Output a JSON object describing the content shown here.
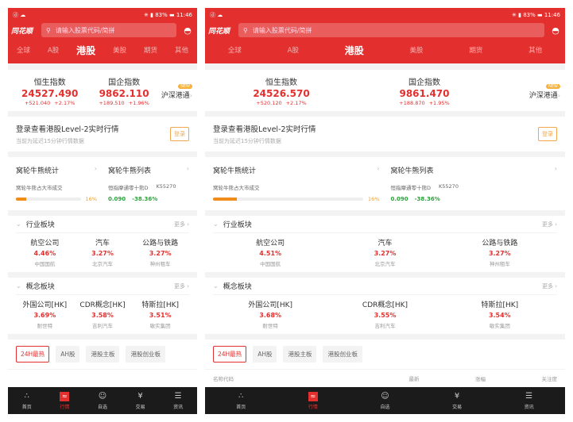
{
  "phones": [
    {
      "status": {
        "left": "ⓓ ☁",
        "right": "✳ ▮ 83% ▬ 11:46"
      },
      "logo": "同花顺",
      "search_placeholder": "请输入股票代码/简拼",
      "tabs": [
        "全球",
        "A股",
        "港股",
        "美股",
        "期货",
        "其他"
      ],
      "indices": [
        {
          "name": "恒生指数",
          "value": "24527.490",
          "change": "+521.040",
          "pct": "+2.17%"
        },
        {
          "name": "国企指数",
          "value": "9862.110",
          "change": "+189.510",
          "pct": "+1.96%"
        }
      ],
      "hs_badge": "NEW",
      "hs_label": "沪深港通",
      "login": {
        "title": "登录查看港股Level-2实时行情",
        "sub": "当前为延迟15分钟行情数据",
        "button": "登录"
      },
      "warrant": {
        "stats_title": "窝轮牛熊统计",
        "stats_sub": "窝轮牛熊占大市成交",
        "stats_pct": "16%",
        "stats_frac": 0.16,
        "list_title": "窝轮牛熊列表",
        "list_name": "恒指摩通零十熊D",
        "list_code": "K55270",
        "list_price": "0.090",
        "list_pct": "-38.36%"
      },
      "industry": {
        "title": "行业板块",
        "more": "更多",
        "items": [
          {
            "name": "航空公司",
            "pct": "4.46%",
            "stock": "中国国航"
          },
          {
            "name": "汽车",
            "pct": "3.27%",
            "stock": "北京汽车"
          },
          {
            "name": "公路与铁路",
            "pct": "3.27%",
            "stock": "神州租车"
          }
        ]
      },
      "concept": {
        "title": "概念板块",
        "more": "更多",
        "items": [
          {
            "name": "外国公司[HK]",
            "pct": "3.69%",
            "stock": "耐世特"
          },
          {
            "name": "CDR概念[HK]",
            "pct": "3.58%",
            "stock": "吉利汽车"
          },
          {
            "name": "特斯拉[HK]",
            "pct": "3.51%",
            "stock": "敏实集团"
          }
        ]
      },
      "chips": [
        "24H最热",
        "AH股",
        "港股主板",
        "港股创业板"
      ],
      "nav": [
        {
          "icon": "∴",
          "label": "首页"
        },
        {
          "icon": "≈",
          "label": "行情"
        },
        {
          "icon": "☺",
          "label": "自选"
        },
        {
          "icon": "¥",
          "label": "交易"
        },
        {
          "icon": "☰",
          "label": "资讯"
        }
      ]
    },
    {
      "status": {
        "left": "ⓓ ☁",
        "right": "✳ ▮ 83% ▬ 11:46"
      },
      "logo": "同花顺",
      "search_placeholder": "请输入股票代码/简拼",
      "tabs": [
        "全球",
        "A股",
        "港股",
        "美股",
        "期货",
        "其他"
      ],
      "indices": [
        {
          "name": "恒生指数",
          "value": "24526.570",
          "change": "+520.120",
          "pct": "+2.17%"
        },
        {
          "name": "国企指数",
          "value": "9861.470",
          "change": "+188.870",
          "pct": "+1.95%"
        }
      ],
      "hs_badge": "NEW",
      "hs_label": "沪深港通",
      "login": {
        "title": "登录查看港股Level-2实时行情",
        "sub": "当前为延迟15分钟行情数据",
        "button": "登录"
      },
      "warrant": {
        "stats_title": "窝轮牛熊统计",
        "stats_sub": "窝轮牛熊占大市成交",
        "stats_pct": "16%",
        "stats_frac": 0.16,
        "list_title": "窝轮牛熊列表",
        "list_name": "恒指摩通零十熊D",
        "list_code": "K55270",
        "list_price": "0.090",
        "list_pct": "-38.36%"
      },
      "industry": {
        "title": "行业板块",
        "more": "更多",
        "items": [
          {
            "name": "航空公司",
            "pct": "4.51%",
            "stock": "中国国航"
          },
          {
            "name": "汽车",
            "pct": "3.27%",
            "stock": "北京汽车"
          },
          {
            "name": "公路与铁路",
            "pct": "3.27%",
            "stock": "神州租车"
          }
        ]
      },
      "concept": {
        "title": "概念板块",
        "more": "更多",
        "items": [
          {
            "name": "外国公司[HK]",
            "pct": "3.68%",
            "stock": "耐世特"
          },
          {
            "name": "CDR概念[HK]",
            "pct": "3.55%",
            "stock": "吉利汽车"
          },
          {
            "name": "特斯拉[HK]",
            "pct": "3.54%",
            "stock": "敏实集团"
          }
        ]
      },
      "chips": [
        "24H最热",
        "AH股",
        "港股主板",
        "港股创业板"
      ],
      "columns": [
        "名称代码",
        "最新",
        "涨幅",
        "关注度"
      ],
      "nav": [
        {
          "icon": "∴",
          "label": "首页"
        },
        {
          "icon": "≈",
          "label": "行情"
        },
        {
          "icon": "☺",
          "label": "自选"
        },
        {
          "icon": "¥",
          "label": "交易"
        },
        {
          "icon": "☰",
          "label": "资讯"
        }
      ]
    }
  ]
}
